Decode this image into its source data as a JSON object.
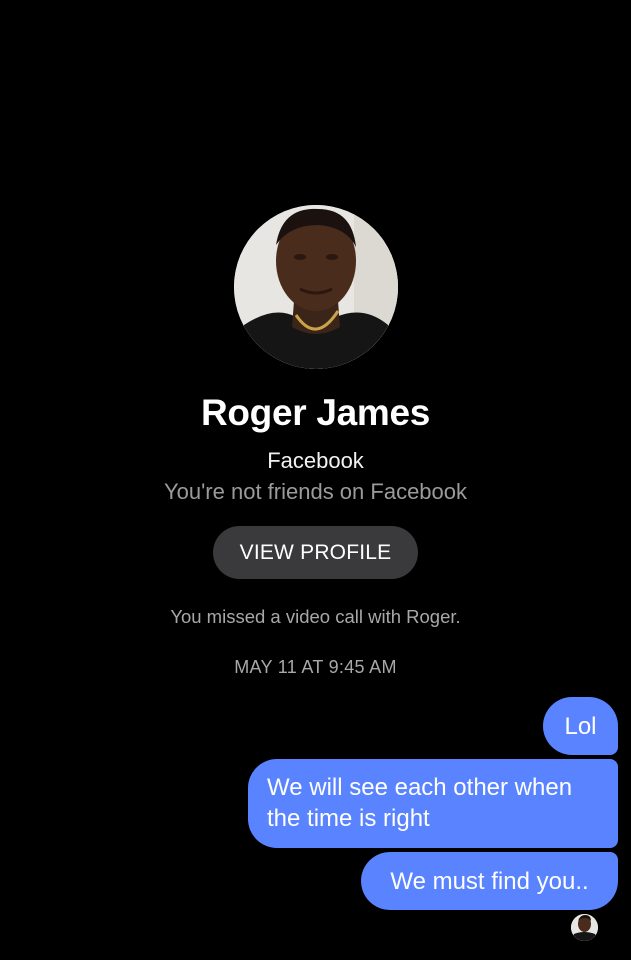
{
  "contact": {
    "name": "Roger James",
    "platform": "Facebook",
    "friend_status": "You're not friends on Facebook",
    "view_profile_label": "VIEW PROFILE"
  },
  "thread": {
    "missed_call": "You missed a video call with Roger.",
    "timestamp": "MAY 11 AT 9:45 AM",
    "messages": [
      {
        "text": "Lol",
        "from": "me"
      },
      {
        "text": "We will see each other when the time is right",
        "from": "me"
      },
      {
        "text": "We must find you..",
        "from": "me"
      }
    ]
  },
  "colors": {
    "background": "#000000",
    "outgoing_bubble": "#5a84ff",
    "button_bg": "#3a3a3c",
    "secondary_text": "#9b9b9b"
  }
}
